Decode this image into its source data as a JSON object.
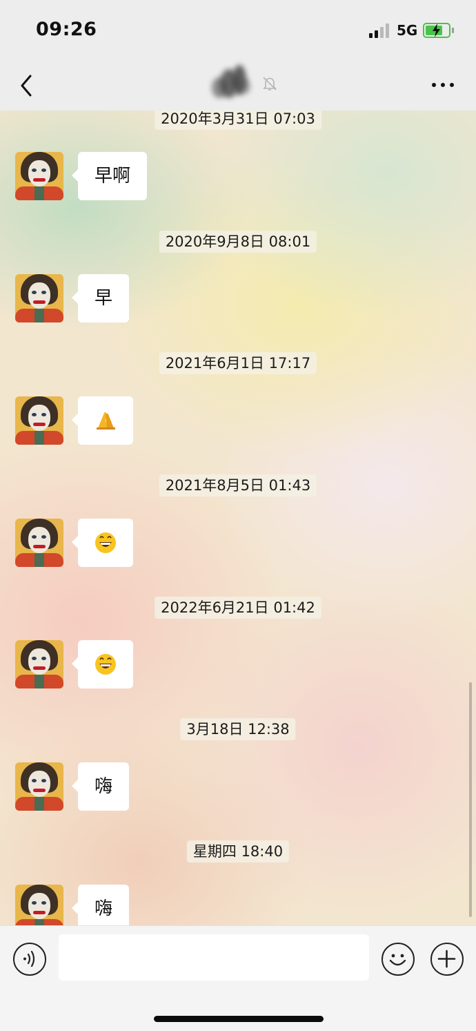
{
  "status_bar": {
    "time": "09:26",
    "network": "5G",
    "battery_level": 0.7,
    "battery_charging": true
  },
  "navbar": {
    "back_icon": "chevron-left-icon",
    "title_obscured": true,
    "mute_icon": "bell-off-icon",
    "more_icon": "ellipsis-icon"
  },
  "messages": [
    {
      "timestamp": "2020年3月31日 07:03",
      "sender": "contact",
      "text": "早啊"
    },
    {
      "timestamp": "2020年9月8日 08:01",
      "sender": "contact",
      "text": "早"
    },
    {
      "timestamp": "2021年6月1日 17:17",
      "sender": "contact",
      "emoji": "praying-hands-emoji"
    },
    {
      "timestamp": "2021年8月5日 01:43",
      "sender": "contact",
      "emoji": "grinning-face-emoji"
    },
    {
      "timestamp": "2022年6月21日 01:42",
      "sender": "contact",
      "emoji": "grinning-face-emoji"
    },
    {
      "timestamp": "3月18日 12:38",
      "sender": "contact",
      "text": "嗨"
    },
    {
      "timestamp": "星期四 18:40",
      "sender": "contact",
      "text": "嗨"
    }
  ],
  "input_bar": {
    "voice_icon": "voice-wave-icon",
    "emoji_icon": "smiley-icon",
    "plus_icon": "plus-circle-icon",
    "text_value": ""
  },
  "colors": {
    "bar_background": "#ededed",
    "bubble_background": "#ffffff",
    "battery_green": "#4ac34a"
  }
}
